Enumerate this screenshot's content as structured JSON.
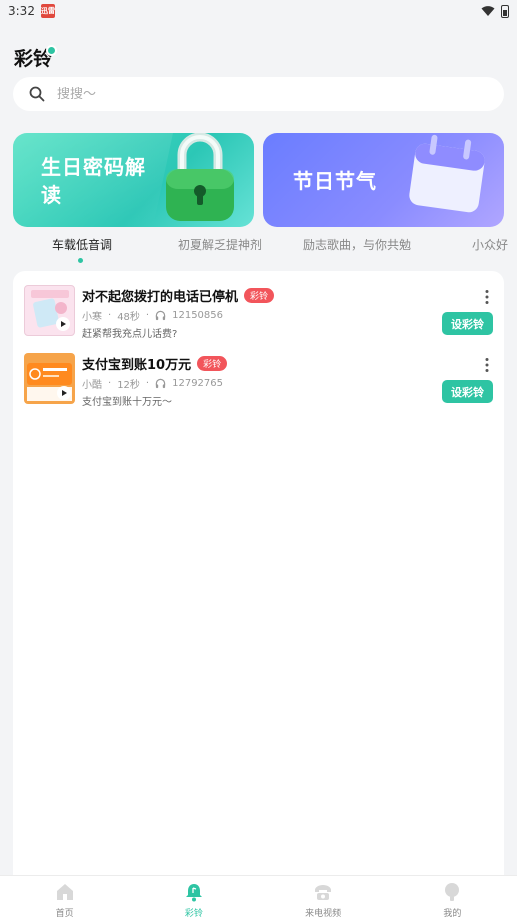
{
  "status_bar": {
    "time": "3:32",
    "app_badge": "迅雷"
  },
  "header": {
    "title": "彩铃"
  },
  "search": {
    "placeholder": "搜搜～"
  },
  "banners": [
    {
      "title": "生日密码解读",
      "color": "#2ec4b6"
    },
    {
      "title": "节日节气",
      "color": "#6f7dff"
    }
  ],
  "tabs": [
    {
      "label": "车载低音调",
      "active": true
    },
    {
      "label": "初夏解乏提神剂",
      "active": false
    },
    {
      "label": "励志歌曲，与你共勉",
      "active": false
    },
    {
      "label": "小众好",
      "active": false
    }
  ],
  "ringtones": [
    {
      "title": "对不起您拨打的电话已停机",
      "tag": "彩铃",
      "author": "小寒",
      "duration": "48秒",
      "plays": "12150856",
      "desc": "赶紧帮我充点儿话费?",
      "button": "设彩铃"
    },
    {
      "title": "支付宝到账10万元",
      "tag": "彩铃",
      "author": "小酷",
      "duration": "12秒",
      "plays": "12792765",
      "desc": "支付宝到账十万元～",
      "button": "设彩铃"
    }
  ],
  "bottom_nav": [
    {
      "label": "首页",
      "icon": "home-icon",
      "active": false
    },
    {
      "label": "彩铃",
      "icon": "bell-icon",
      "active": true
    },
    {
      "label": "来电视频",
      "icon": "phone-icon",
      "active": false
    },
    {
      "label": "我的",
      "icon": "profile-icon",
      "active": false
    }
  ],
  "colors": {
    "accent": "#2ec4a3",
    "tag": "#f2555b"
  }
}
